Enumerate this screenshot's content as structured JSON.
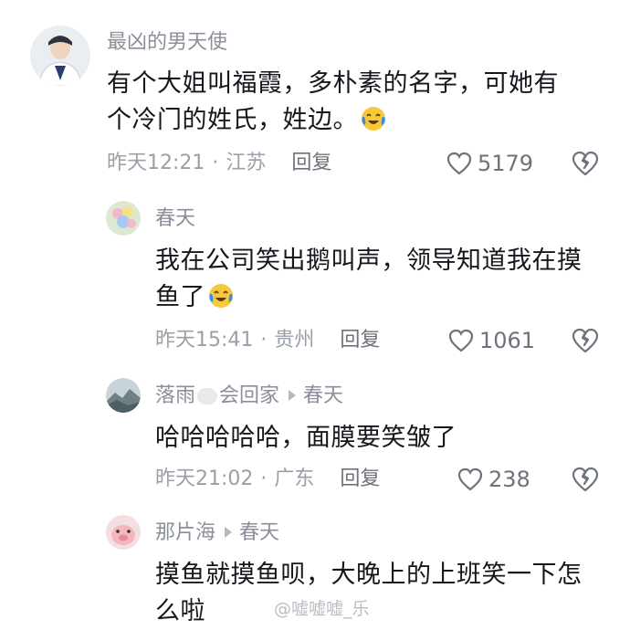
{
  "comments": [
    {
      "username": "最凶的男天使",
      "text_lines": [
        "有个大姐叫福霞，多朴素的名字，可她有",
        "个冷门的姓氏，姓边。"
      ],
      "emoji": "laughing-crying-emoji",
      "time": "昨天12:21",
      "location": "江苏",
      "reply": "回复",
      "likes": "5179"
    },
    {
      "username": "春天",
      "text_lines": [
        "我在公司笑出鹅叫声，领导知道我在摸",
        "鱼了"
      ],
      "emoji": "laughing-crying-emoji",
      "time": "昨天15:41",
      "location": "贵州",
      "reply": "回复",
      "likes": "1061"
    },
    {
      "username_a": "落雨",
      "username_b": "会回家",
      "reply_to": "春天",
      "text_lines": [
        "哈哈哈哈哈，面膜要笑皱了"
      ],
      "time": "昨天21:02",
      "location": "广东",
      "reply": "回复",
      "likes": "238"
    },
    {
      "username": "那片海",
      "reply_to": "春天",
      "text_lines": [
        "摸鱼就摸鱼呗，大晚上的上班笑一下怎",
        "么啦"
      ]
    }
  ],
  "meta_separator": "·",
  "watermark": "@嘘嘘嘘_乐",
  "colors": {
    "text": "#15171c",
    "secondary": "#8a8f99",
    "emoji_yellow": "#f7c93a",
    "emoji_tears": "#3a8ee6"
  }
}
